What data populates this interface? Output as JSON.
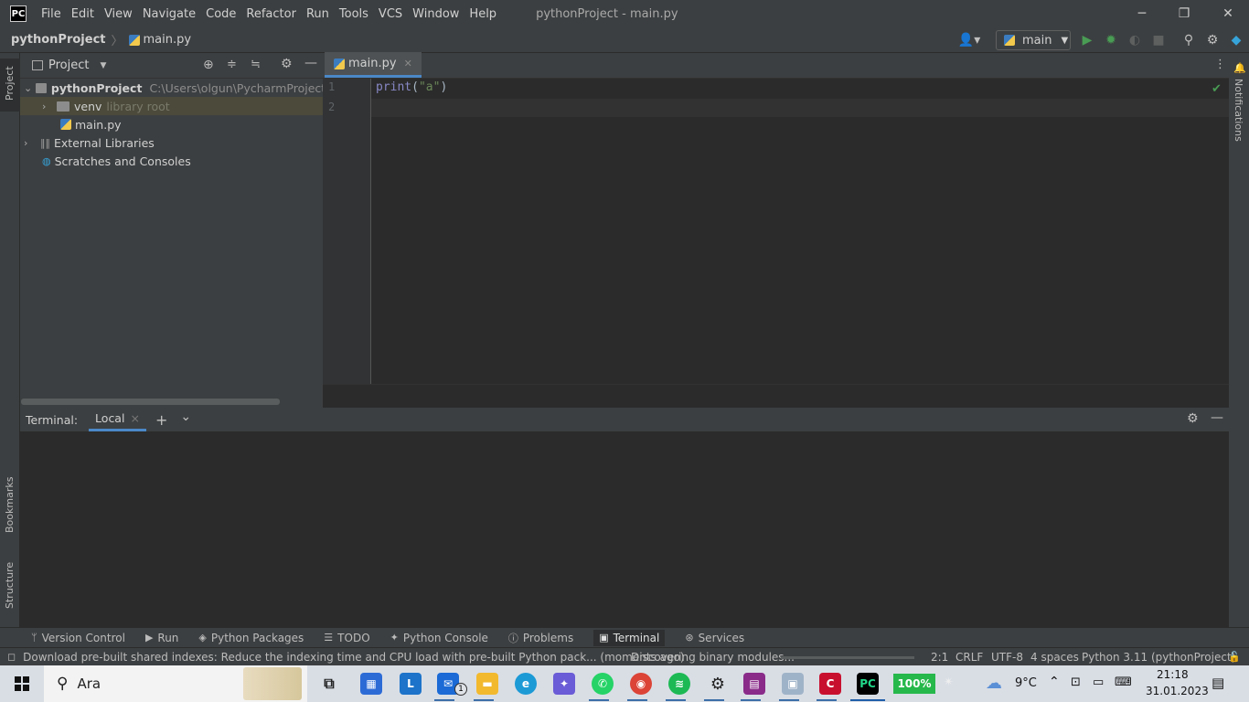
{
  "titlebar": {
    "logo": "PC",
    "menu": [
      "File",
      "Edit",
      "View",
      "Navigate",
      "Code",
      "Refactor",
      "Run",
      "Tools",
      "VCS",
      "Window",
      "Help"
    ],
    "window_title": "pythonProject - main.py",
    "minimize": "─",
    "restore": "❐",
    "close": "✕"
  },
  "navbar": {
    "project": "pythonProject",
    "file": "main.py",
    "run_config": "main"
  },
  "left_stripe": {
    "project": "Project",
    "bookmarks": "Bookmarks",
    "structure": "Structure"
  },
  "right_stripe": {
    "notifications": "Notifications"
  },
  "project_panel": {
    "title": "Project",
    "tree": [
      {
        "name": "pythonProject",
        "detail": "C:\\Users\\olgun\\PycharmProjects\\pyth"
      },
      {
        "name": "venv",
        "detail": "library root"
      },
      {
        "name": "main.py",
        "detail": ""
      },
      {
        "name": "External Libraries",
        "detail": ""
      },
      {
        "name": "Scratches and Consoles",
        "detail": ""
      }
    ]
  },
  "editor": {
    "tab": "main.py",
    "lines": [
      {
        "num": "1",
        "code_fn": "print",
        "code_open": "(",
        "code_str": "\"a\"",
        "code_close": ")"
      },
      {
        "num": "2"
      }
    ]
  },
  "terminal": {
    "label": "Terminal:",
    "tab": "Local",
    "close": "×",
    "add": "+",
    "dropdown": "⌄"
  },
  "tool_windows": [
    "Version Control",
    "Run",
    "Python Packages",
    "TODO",
    "Python Console",
    "Problems",
    "Terminal",
    "Services"
  ],
  "statusbar": {
    "message": "Download pre-built shared indexes: Reduce the indexing time and CPU load with pre-built Python pack... (moments ago)",
    "progress_text": "Discovering binary modules...",
    "position": "2:1",
    "line_sep": "CRLF",
    "encoding": "UTF-8",
    "indent": "4 spaces",
    "interpreter": "Python 3.11 (pythonProject)"
  },
  "taskbar": {
    "search": "Ara",
    "battery": "100%",
    "weather": "9°C",
    "time": "21:18",
    "date": "31.01.2023",
    "mail_badge": "1"
  },
  "colors": {
    "accent": "#4a88c7",
    "run_green": "#499c54",
    "string": "#6a8759"
  }
}
